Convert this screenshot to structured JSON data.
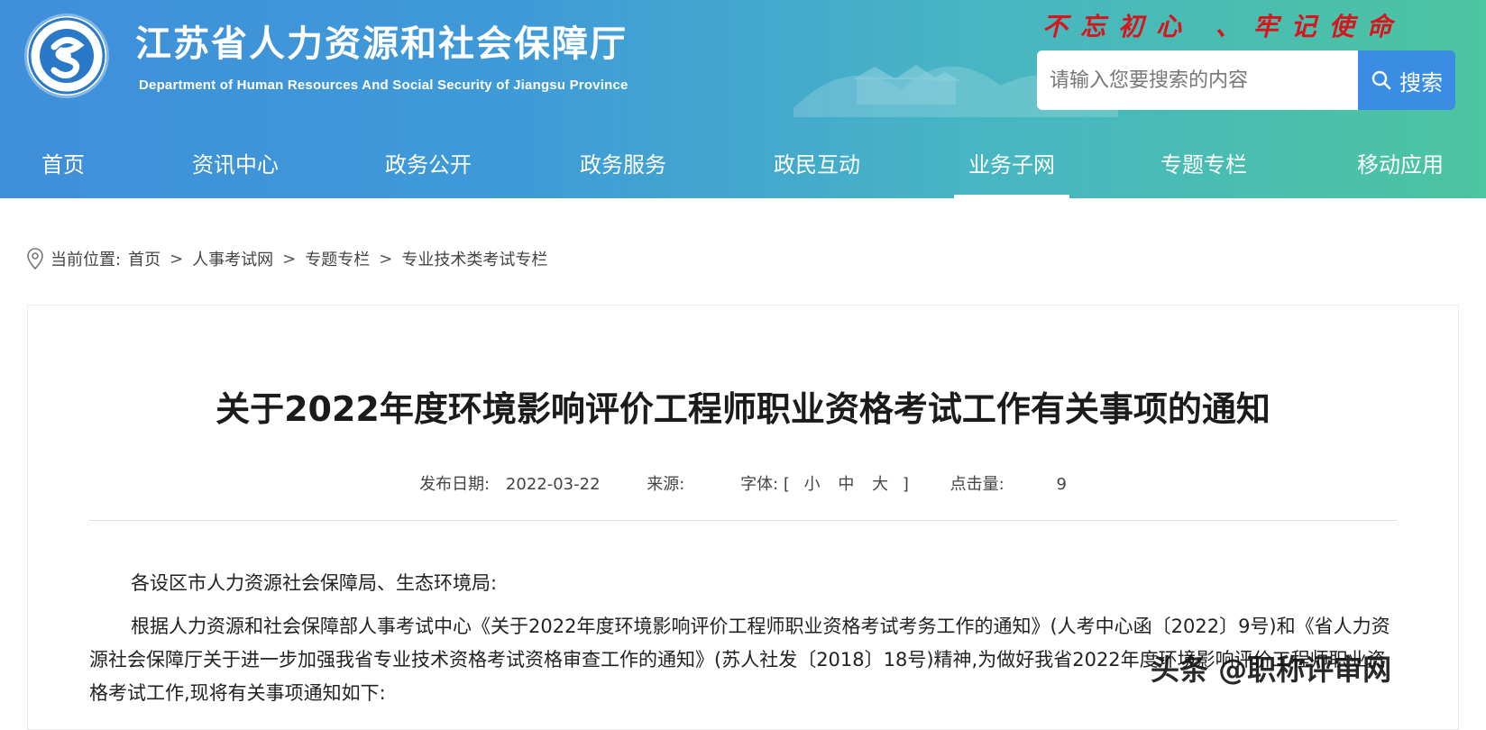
{
  "header": {
    "title": "江苏省人力资源和社会保障厅",
    "subtitle": "Department of Human Resources And Social Security of Jiangsu Province",
    "slogan": "不忘初心 、牢记使命",
    "search": {
      "placeholder": "请输入您要搜索的内容",
      "button_label": "搜索"
    }
  },
  "nav": {
    "items": [
      {
        "label": "首页"
      },
      {
        "label": "资讯中心"
      },
      {
        "label": "政务公开"
      },
      {
        "label": "政务服务"
      },
      {
        "label": "政民互动"
      },
      {
        "label": "业务子网",
        "active": true
      },
      {
        "label": "专题专栏"
      },
      {
        "label": "移动应用"
      }
    ]
  },
  "breadcrumb": {
    "prefix": "当前位置:",
    "items": [
      "首页",
      "人事考试网",
      "专题专栏",
      "专业技术类考试专栏"
    ],
    "separator": ">"
  },
  "article": {
    "title": "关于2022年度环境影响评价工程师职业资格考试工作有关事项的通知",
    "meta": {
      "date_label": "发布日期:",
      "date": "2022-03-22",
      "source_label": "来源:",
      "source": "",
      "font_label": "字体:",
      "font_open": "[",
      "font_small": "小",
      "font_medium": "中",
      "font_large": "大",
      "font_close": "]",
      "clicks_label": "点击量:",
      "clicks": "9"
    },
    "paragraphs": [
      "各设区市人力资源社会保障局、生态环境局:",
      "根据人力资源和社会保障部人事考试中心《关于2022年度环境影响评价工程师职业资格考试考务工作的通知》(人考中心函〔2022〕9号)和《省人力资源社会保障厅关于进一步加强我省专业技术资格考试资格审查工作的通知》(苏人社发〔2018〕18号)精神,为做好我省2022年度环境影响评价工程师职业资格考试工作,现将有关事项通知如下:"
    ]
  },
  "watermark": "头条 @职称评审网",
  "colors": {
    "header_start": "#3f8fd9",
    "header_end": "#4cc5a0",
    "slogan": "#d9141c",
    "search_button": "#3b8de3"
  }
}
